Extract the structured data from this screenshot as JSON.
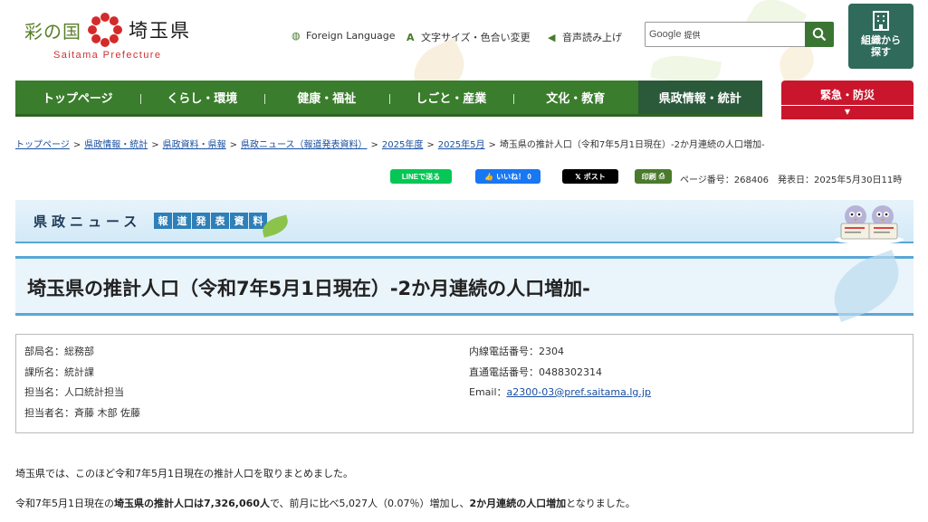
{
  "header": {
    "logo_sai": "彩の国",
    "logo_ken": "埼玉県",
    "logo_en": "Saitama Prefecture",
    "utility": [
      "Foreign Language",
      "文字サイズ・色合い変更",
      "音声読み上げ"
    ],
    "search_brand": "Google",
    "search_placeholder": "提供",
    "org_button": [
      "組織から",
      "探す"
    ]
  },
  "nav": {
    "items": [
      "トップページ",
      "くらし・環境",
      "健康・福祉",
      "しごと・産業",
      "文化・教育",
      "県政情報・統計"
    ],
    "active_index": 5,
    "emergency": "緊急・防災"
  },
  "breadcrumb": {
    "links": [
      "トップページ",
      "県政情報・統計",
      "県政資料・県報",
      "県政ニュース（報道発表資料）",
      "2025年度",
      "2025年5月"
    ],
    "current": "埼玉県の推計人口（令和7年5月1日現在）-2か月連続の人口増加-"
  },
  "share": {
    "line": "LINEで送る",
    "facebook": "いいね！ 0",
    "x": "ポスト",
    "print": "印刷",
    "page_info": "ページ番号：268406　発表日：2025年5月30日11時"
  },
  "banner": {
    "title": "県政ニュース",
    "tags": [
      "報",
      "道",
      "発",
      "表",
      "資",
      "料"
    ]
  },
  "page_title": "埼玉県の推計人口（令和7年5月1日現在）-2か月連続の人口増加-",
  "contact": {
    "left": [
      "部局名：総務部",
      "課所名：統計課",
      "担当名：人口統計担当",
      "担当者名：斉藤 木部 佐藤"
    ],
    "right_phone1": "内線電話番号：2304",
    "right_phone2": "直通電話番号：0488302314",
    "email_label": "Email：",
    "email": "a2300-03@pref.saitama.lg.jp"
  },
  "body": {
    "p1": "埼玉県では、このほど令和7年5月1日現在の推計人口を取りまとめました。",
    "p2_a": "令和7年5月1日現在の",
    "p2_b": "埼玉県の推計人口は7,326,060人",
    "p2_c": "で、前月に比べ5,027人（0.07％）増加し、",
    "p2_d": "2か月連続の人口増加",
    "p2_e": "となりました。"
  },
  "colors": {
    "nav_green": "#3a7d2c",
    "emergency_red": "#c9162d",
    "banner_blue": "#5aa6d8",
    "org_button": "#2f6a5a"
  }
}
